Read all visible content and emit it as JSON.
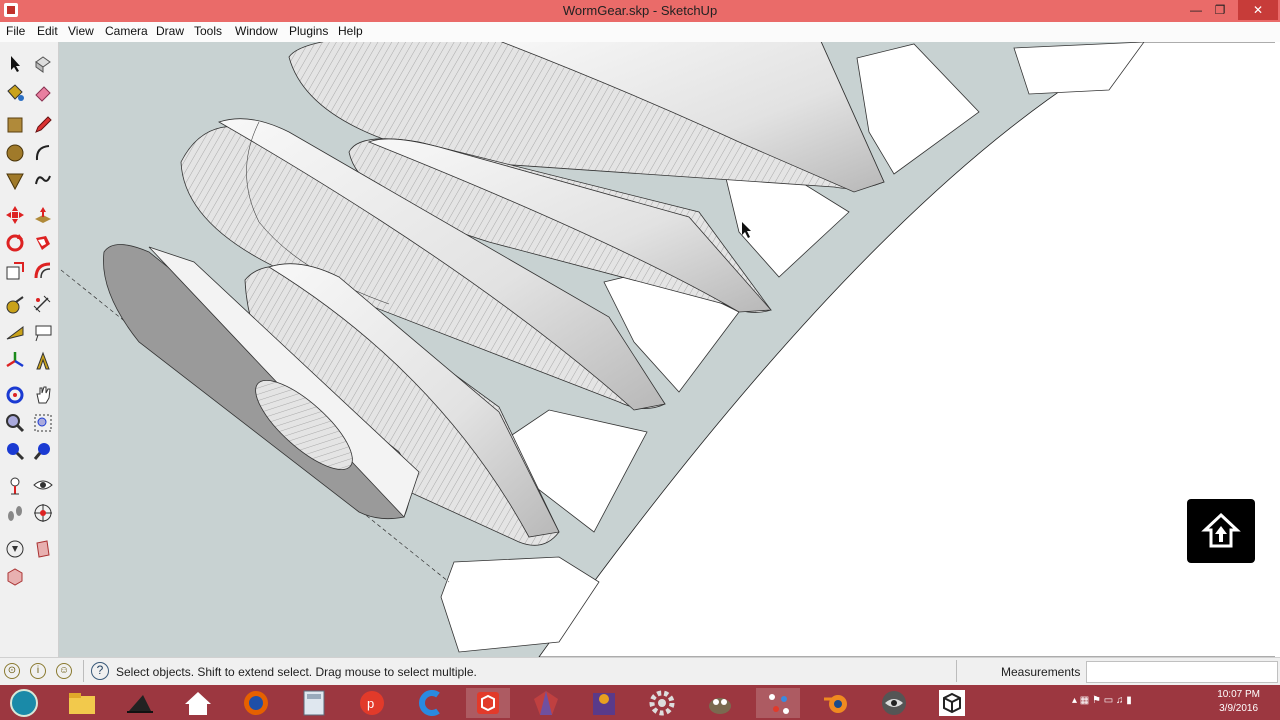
{
  "window": {
    "title": "WormGear.skp - SketchUp",
    "controls": [
      "—",
      "❐",
      "✕"
    ]
  },
  "menu": [
    "File",
    "Edit",
    "View",
    "Camera",
    "Draw",
    "Tools",
    "Window",
    "Plugins",
    "Help"
  ],
  "toolbar": {
    "tools": [
      "select-tool",
      "make-component-tool",
      "paint-bucket-tool",
      "eraser-tool",
      "rectangle-tool",
      "line-tool",
      "circle-tool",
      "arc-tool",
      "polygon-tool",
      "freehand-tool",
      "move-tool",
      "push-pull-tool",
      "rotate-tool",
      "follow-me-tool",
      "scale-tool",
      "offset-tool",
      "tape-measure-tool",
      "dimension-tool",
      "protractor-tool",
      "text-tool",
      "axes-tool",
      "3d-text-tool",
      "orbit-tool",
      "pan-tool",
      "zoom-tool",
      "zoom-window-tool",
      "zoom-extents-tool",
      "previous-view-tool",
      "position-camera-tool",
      "look-around-tool",
      "walk-tool",
      "section-plane-tool",
      "get-models-tool",
      "share-model-tool",
      "extension-warehouse-tool"
    ]
  },
  "status": {
    "text": "Select objects. Shift to extend select. Drag mouse to select multiple.",
    "measurements_label": "Measurements",
    "measurements_value": ""
  },
  "taskbar": {
    "apps": [
      "start",
      "file-explorer",
      "witch-hat-app",
      "home-app",
      "firefox",
      "calculator",
      "pdf-app",
      "ccleaner",
      "sketchup",
      "gem-app",
      "media-app",
      "settings-app",
      "gimp",
      "dots-app",
      "blender",
      "eye-app",
      "cube-app"
    ],
    "time": "10:07 PM",
    "date": "3/9/2016"
  },
  "colors": {
    "titlebar": "#ea6b69",
    "taskbar": "#9c3740",
    "viewport_bg": "#c8d2d2"
  }
}
